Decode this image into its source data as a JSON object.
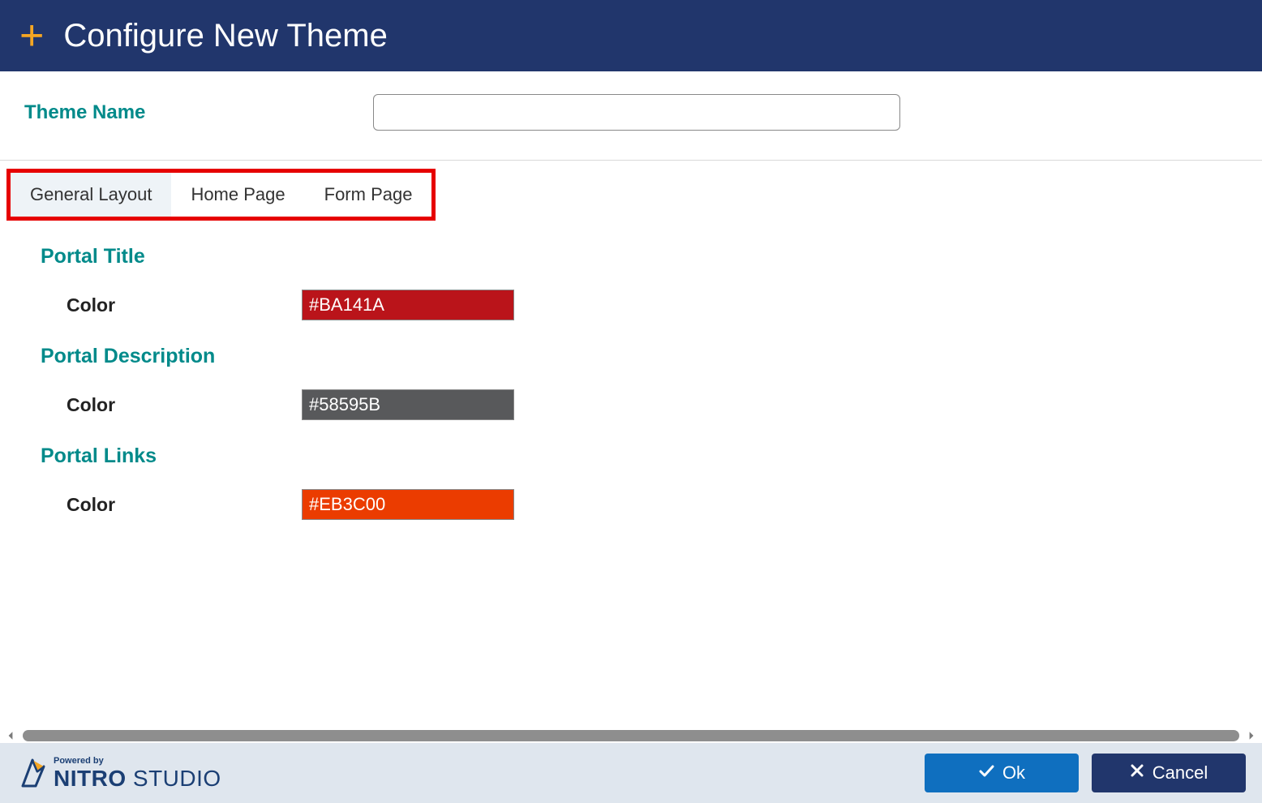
{
  "header": {
    "title": "Configure New Theme"
  },
  "form": {
    "theme_name_label": "Theme Name",
    "theme_name_value": ""
  },
  "tabs": [
    {
      "label": "General Layout",
      "active": true
    },
    {
      "label": "Home Page",
      "active": false
    },
    {
      "label": "Form Page",
      "active": false
    }
  ],
  "sections": [
    {
      "title": "Portal Title",
      "field_label": "Color",
      "value": "#BA141A",
      "bg": "#BA141A"
    },
    {
      "title": "Portal Description",
      "field_label": "Color",
      "value": "#58595B",
      "bg": "#58595B"
    },
    {
      "title": "Portal Links",
      "field_label": "Color",
      "value": "#EB3C00",
      "bg": "#EB3C00"
    }
  ],
  "footer": {
    "powered_by": "Powered by",
    "brand_strong": "NITRO",
    "brand_light": " STUDIO",
    "ok_label": "Ok",
    "cancel_label": "Cancel"
  }
}
